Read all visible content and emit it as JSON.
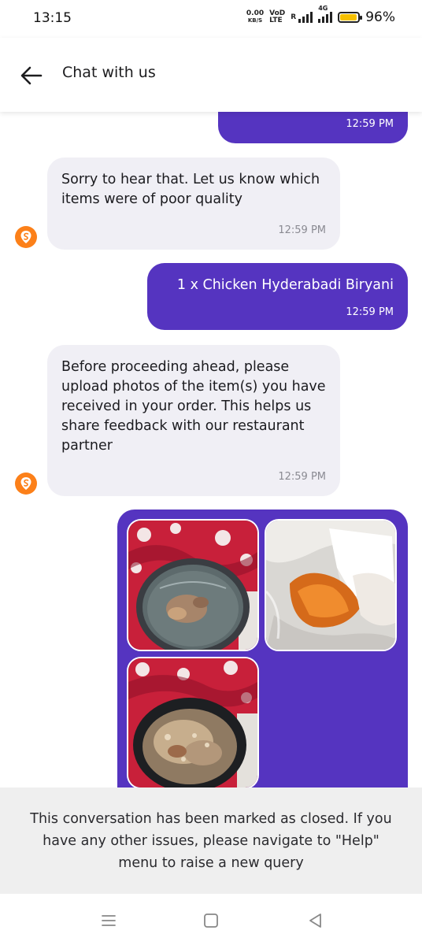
{
  "status_bar": {
    "time": "13:15",
    "net_speed_value": "0.00",
    "net_speed_unit": "KB/S",
    "volte_top": "VoD",
    "volte_bottom": "LTE",
    "roaming": "R",
    "network_type": "4G",
    "battery_percent": "96%",
    "battery_level": 0.96
  },
  "header": {
    "title": "Chat with us"
  },
  "messages": [
    {
      "from": "user",
      "text": "",
      "time": "12:59 PM"
    },
    {
      "from": "agent",
      "text": "Sorry to hear that. Let us know which items were of poor quality",
      "time": "12:59 PM"
    },
    {
      "from": "user",
      "text": "1 x Chicken Hyderabadi Biryani",
      "time": "12:59 PM"
    },
    {
      "from": "agent",
      "text": "Before proceeding ahead, please upload photos of the item(s) you have received in your order. This helps us share feedback with our restaurant partner",
      "time": "12:59 PM"
    }
  ],
  "photos": [
    {
      "icon": "biryani-container-photo"
    },
    {
      "icon": "packaging-photo"
    },
    {
      "icon": "biryani-rice-photo"
    }
  ],
  "closed_banner": {
    "text": "This conversation has been marked as closed. If you have any other issues, please navigate to \"Help\" menu to raise a new query"
  },
  "colors": {
    "sent_bubble": "#5534c0",
    "received_bubble": "#f0eff5",
    "brand_orange": "#fc8019"
  },
  "nav_bar": {
    "icons": [
      "menu-icon",
      "home-square-icon",
      "back-triangle-icon"
    ]
  }
}
